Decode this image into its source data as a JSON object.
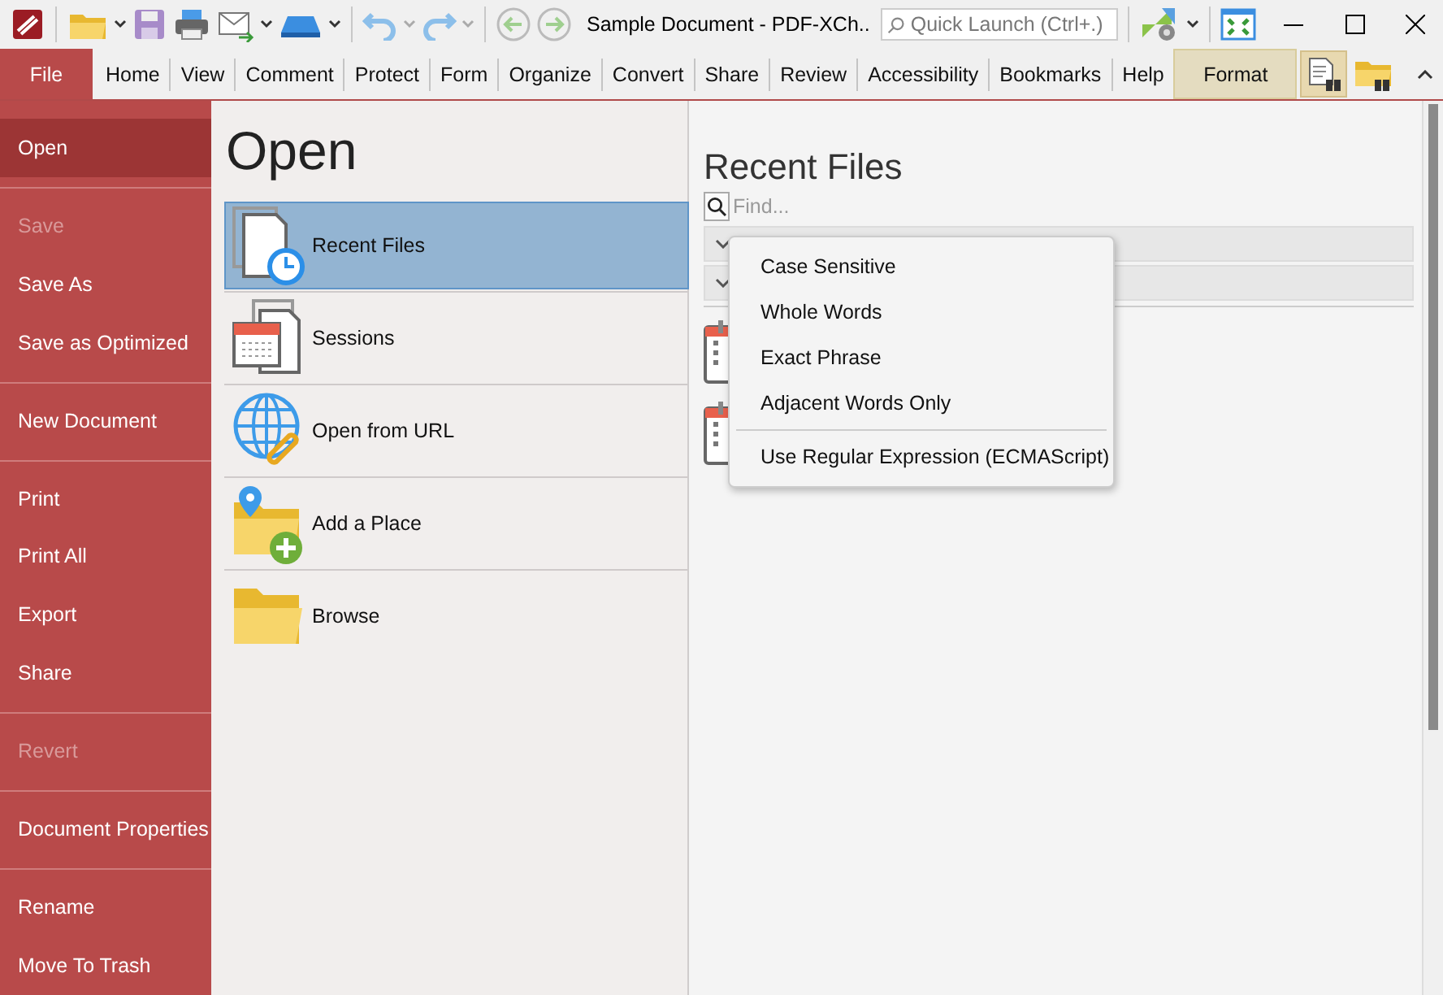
{
  "title_bar": {
    "title": "Sample Document - PDF-XCh..",
    "quick_launch": {
      "placeholder": "Quick Launch (Ctrl+.)"
    }
  },
  "ribbon_tabs": [
    {
      "label": "File",
      "kind": "file",
      "selected": true
    },
    {
      "label": "Home",
      "kind": "tab",
      "selected": false
    },
    {
      "label": "View",
      "kind": "tab",
      "selected": false
    },
    {
      "label": "Comment",
      "kind": "tab",
      "selected": false
    },
    {
      "label": "Protect",
      "kind": "tab",
      "selected": false
    },
    {
      "label": "Form",
      "kind": "tab",
      "selected": false
    },
    {
      "label": "Organize",
      "kind": "tab",
      "selected": false
    },
    {
      "label": "Convert",
      "kind": "tab",
      "selected": false
    },
    {
      "label": "Share",
      "kind": "tab",
      "selected": false
    },
    {
      "label": "Review",
      "kind": "tab",
      "selected": false
    },
    {
      "label": "Accessibility",
      "kind": "tab",
      "selected": false
    },
    {
      "label": "Bookmarks",
      "kind": "tab",
      "selected": false
    },
    {
      "label": "Help",
      "kind": "tab",
      "selected": false
    },
    {
      "label": "Format",
      "kind": "context",
      "selected": false
    }
  ],
  "sidebar": {
    "groups": [
      [
        {
          "label": "Open",
          "selected": true,
          "disabled": false
        }
      ],
      [
        {
          "label": "Save",
          "selected": false,
          "disabled": true
        },
        {
          "label": "Save As",
          "selected": false,
          "disabled": false
        },
        {
          "label": "Save as Optimized",
          "selected": false,
          "disabled": false
        }
      ],
      [
        {
          "label": "New Document",
          "selected": false,
          "disabled": false
        }
      ],
      [
        {
          "label": "Print",
          "selected": false,
          "disabled": false
        },
        {
          "label": "Print All",
          "selected": false,
          "disabled": false
        },
        {
          "label": "Export",
          "selected": false,
          "disabled": false
        },
        {
          "label": "Share",
          "selected": false,
          "disabled": false
        }
      ],
      [
        {
          "label": "Revert",
          "selected": false,
          "disabled": true
        }
      ],
      [
        {
          "label": "Document Properties",
          "selected": false,
          "disabled": false
        }
      ],
      [
        {
          "label": "Rename",
          "selected": false,
          "disabled": false
        },
        {
          "label": "Move To Trash",
          "selected": false,
          "disabled": false
        }
      ]
    ]
  },
  "open_panel": {
    "title": "Open",
    "items": [
      {
        "label": "Recent Files",
        "kind": "recent",
        "selected": true
      },
      {
        "label": "Sessions",
        "kind": "sessions",
        "selected": false
      },
      {
        "label": "Open from URL",
        "kind": "url",
        "selected": false
      },
      {
        "label": "Add a Place",
        "kind": "place",
        "selected": false
      },
      {
        "label": "Browse",
        "kind": "browse",
        "selected": false
      }
    ]
  },
  "recent_panel": {
    "title": "Recent Files",
    "find": {
      "placeholder": "Find..."
    },
    "search_options_menu": {
      "groups": [
        [
          "Case Sensitive",
          "Whole Words",
          "Exact Phrase",
          "Adjacent Words Only"
        ],
        [
          "Use Regular Expression (ECMAScript)"
        ]
      ]
    }
  }
}
